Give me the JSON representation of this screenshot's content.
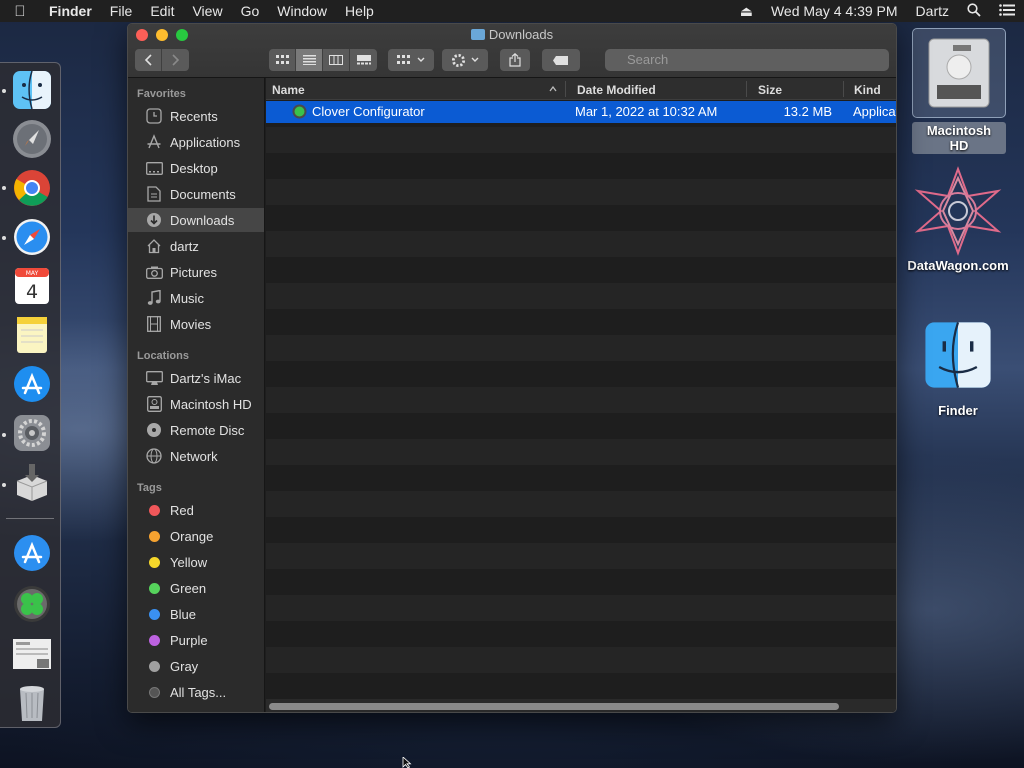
{
  "menubar": {
    "app": "Finder",
    "items": [
      "File",
      "Edit",
      "View",
      "Go",
      "Window",
      "Help"
    ],
    "datetime": "Wed May 4  4:39 PM",
    "user": "Dartz"
  },
  "window": {
    "title": "Downloads",
    "search_placeholder": "Search"
  },
  "sidebar": {
    "favorites_header": "Favorites",
    "favorites": [
      {
        "label": "Recents",
        "icon": "clock-icon"
      },
      {
        "label": "Applications",
        "icon": "applications-icon"
      },
      {
        "label": "Desktop",
        "icon": "desktop-icon"
      },
      {
        "label": "Documents",
        "icon": "document-icon"
      },
      {
        "label": "Downloads",
        "icon": "download-icon"
      },
      {
        "label": "dartz",
        "icon": "home-icon"
      },
      {
        "label": "Pictures",
        "icon": "camera-icon"
      },
      {
        "label": "Music",
        "icon": "music-note-icon"
      },
      {
        "label": "Movies",
        "icon": "film-icon"
      }
    ],
    "locations_header": "Locations",
    "locations": [
      {
        "label": "Dartz's iMac",
        "icon": "computer-icon"
      },
      {
        "label": "Macintosh HD",
        "icon": "disk-icon"
      },
      {
        "label": "Remote Disc",
        "icon": "disc-icon"
      },
      {
        "label": "Network",
        "icon": "globe-icon"
      }
    ],
    "tags_header": "Tags",
    "tags": [
      {
        "label": "Red",
        "color": "#f0575a"
      },
      {
        "label": "Orange",
        "color": "#f5a230"
      },
      {
        "label": "Yellow",
        "color": "#f5d72a"
      },
      {
        "label": "Green",
        "color": "#56d35c"
      },
      {
        "label": "Blue",
        "color": "#3a90f0"
      },
      {
        "label": "Purple",
        "color": "#bd62e0"
      },
      {
        "label": "Gray",
        "color": "#a0a0a0"
      },
      {
        "label": "All Tags...",
        "color": "#555555"
      }
    ]
  },
  "columns": {
    "name": "Name",
    "date": "Date Modified",
    "size": "Size",
    "kind": "Kind"
  },
  "files": [
    {
      "name": "Clover Configurator",
      "date": "Mar 1, 2022 at 10:32 AM",
      "size": "13.2 MB",
      "kind": "Applicat"
    }
  ],
  "desktop": {
    "icons": [
      {
        "label": "Macintosh HD"
      },
      {
        "label": "DataWagon.com"
      },
      {
        "label": "Finder"
      }
    ]
  },
  "colors": {
    "selection": "#0b5bd3",
    "accent": "#3a90f0"
  }
}
